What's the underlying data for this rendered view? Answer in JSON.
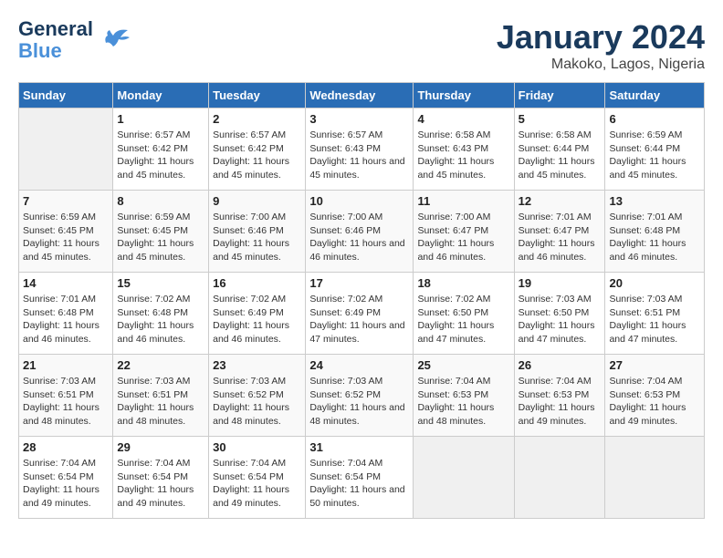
{
  "header": {
    "logo_line1": "General",
    "logo_line2": "Blue",
    "month": "January 2024",
    "location": "Makoko, Lagos, Nigeria"
  },
  "weekdays": [
    "Sunday",
    "Monday",
    "Tuesday",
    "Wednesday",
    "Thursday",
    "Friday",
    "Saturday"
  ],
  "weeks": [
    [
      {
        "day": "",
        "sunrise": "",
        "sunset": "",
        "daylight": ""
      },
      {
        "day": "1",
        "sunrise": "Sunrise: 6:57 AM",
        "sunset": "Sunset: 6:42 PM",
        "daylight": "Daylight: 11 hours and 45 minutes."
      },
      {
        "day": "2",
        "sunrise": "Sunrise: 6:57 AM",
        "sunset": "Sunset: 6:42 PM",
        "daylight": "Daylight: 11 hours and 45 minutes."
      },
      {
        "day": "3",
        "sunrise": "Sunrise: 6:57 AM",
        "sunset": "Sunset: 6:43 PM",
        "daylight": "Daylight: 11 hours and 45 minutes."
      },
      {
        "day": "4",
        "sunrise": "Sunrise: 6:58 AM",
        "sunset": "Sunset: 6:43 PM",
        "daylight": "Daylight: 11 hours and 45 minutes."
      },
      {
        "day": "5",
        "sunrise": "Sunrise: 6:58 AM",
        "sunset": "Sunset: 6:44 PM",
        "daylight": "Daylight: 11 hours and 45 minutes."
      },
      {
        "day": "6",
        "sunrise": "Sunrise: 6:59 AM",
        "sunset": "Sunset: 6:44 PM",
        "daylight": "Daylight: 11 hours and 45 minutes."
      }
    ],
    [
      {
        "day": "7",
        "sunrise": "Sunrise: 6:59 AM",
        "sunset": "Sunset: 6:45 PM",
        "daylight": "Daylight: 11 hours and 45 minutes."
      },
      {
        "day": "8",
        "sunrise": "Sunrise: 6:59 AM",
        "sunset": "Sunset: 6:45 PM",
        "daylight": "Daylight: 11 hours and 45 minutes."
      },
      {
        "day": "9",
        "sunrise": "Sunrise: 7:00 AM",
        "sunset": "Sunset: 6:46 PM",
        "daylight": "Daylight: 11 hours and 45 minutes."
      },
      {
        "day": "10",
        "sunrise": "Sunrise: 7:00 AM",
        "sunset": "Sunset: 6:46 PM",
        "daylight": "Daylight: 11 hours and 46 minutes."
      },
      {
        "day": "11",
        "sunrise": "Sunrise: 7:00 AM",
        "sunset": "Sunset: 6:47 PM",
        "daylight": "Daylight: 11 hours and 46 minutes."
      },
      {
        "day": "12",
        "sunrise": "Sunrise: 7:01 AM",
        "sunset": "Sunset: 6:47 PM",
        "daylight": "Daylight: 11 hours and 46 minutes."
      },
      {
        "day": "13",
        "sunrise": "Sunrise: 7:01 AM",
        "sunset": "Sunset: 6:48 PM",
        "daylight": "Daylight: 11 hours and 46 minutes."
      }
    ],
    [
      {
        "day": "14",
        "sunrise": "Sunrise: 7:01 AM",
        "sunset": "Sunset: 6:48 PM",
        "daylight": "Daylight: 11 hours and 46 minutes."
      },
      {
        "day": "15",
        "sunrise": "Sunrise: 7:02 AM",
        "sunset": "Sunset: 6:48 PM",
        "daylight": "Daylight: 11 hours and 46 minutes."
      },
      {
        "day": "16",
        "sunrise": "Sunrise: 7:02 AM",
        "sunset": "Sunset: 6:49 PM",
        "daylight": "Daylight: 11 hours and 46 minutes."
      },
      {
        "day": "17",
        "sunrise": "Sunrise: 7:02 AM",
        "sunset": "Sunset: 6:49 PM",
        "daylight": "Daylight: 11 hours and 47 minutes."
      },
      {
        "day": "18",
        "sunrise": "Sunrise: 7:02 AM",
        "sunset": "Sunset: 6:50 PM",
        "daylight": "Daylight: 11 hours and 47 minutes."
      },
      {
        "day": "19",
        "sunrise": "Sunrise: 7:03 AM",
        "sunset": "Sunset: 6:50 PM",
        "daylight": "Daylight: 11 hours and 47 minutes."
      },
      {
        "day": "20",
        "sunrise": "Sunrise: 7:03 AM",
        "sunset": "Sunset: 6:51 PM",
        "daylight": "Daylight: 11 hours and 47 minutes."
      }
    ],
    [
      {
        "day": "21",
        "sunrise": "Sunrise: 7:03 AM",
        "sunset": "Sunset: 6:51 PM",
        "daylight": "Daylight: 11 hours and 48 minutes."
      },
      {
        "day": "22",
        "sunrise": "Sunrise: 7:03 AM",
        "sunset": "Sunset: 6:51 PM",
        "daylight": "Daylight: 11 hours and 48 minutes."
      },
      {
        "day": "23",
        "sunrise": "Sunrise: 7:03 AM",
        "sunset": "Sunset: 6:52 PM",
        "daylight": "Daylight: 11 hours and 48 minutes."
      },
      {
        "day": "24",
        "sunrise": "Sunrise: 7:03 AM",
        "sunset": "Sunset: 6:52 PM",
        "daylight": "Daylight: 11 hours and 48 minutes."
      },
      {
        "day": "25",
        "sunrise": "Sunrise: 7:04 AM",
        "sunset": "Sunset: 6:53 PM",
        "daylight": "Daylight: 11 hours and 48 minutes."
      },
      {
        "day": "26",
        "sunrise": "Sunrise: 7:04 AM",
        "sunset": "Sunset: 6:53 PM",
        "daylight": "Daylight: 11 hours and 49 minutes."
      },
      {
        "day": "27",
        "sunrise": "Sunrise: 7:04 AM",
        "sunset": "Sunset: 6:53 PM",
        "daylight": "Daylight: 11 hours and 49 minutes."
      }
    ],
    [
      {
        "day": "28",
        "sunrise": "Sunrise: 7:04 AM",
        "sunset": "Sunset: 6:54 PM",
        "daylight": "Daylight: 11 hours and 49 minutes."
      },
      {
        "day": "29",
        "sunrise": "Sunrise: 7:04 AM",
        "sunset": "Sunset: 6:54 PM",
        "daylight": "Daylight: 11 hours and 49 minutes."
      },
      {
        "day": "30",
        "sunrise": "Sunrise: 7:04 AM",
        "sunset": "Sunset: 6:54 PM",
        "daylight": "Daylight: 11 hours and 49 minutes."
      },
      {
        "day": "31",
        "sunrise": "Sunrise: 7:04 AM",
        "sunset": "Sunset: 6:54 PM",
        "daylight": "Daylight: 11 hours and 50 minutes."
      },
      {
        "day": "",
        "sunrise": "",
        "sunset": "",
        "daylight": ""
      },
      {
        "day": "",
        "sunrise": "",
        "sunset": "",
        "daylight": ""
      },
      {
        "day": "",
        "sunrise": "",
        "sunset": "",
        "daylight": ""
      }
    ]
  ]
}
